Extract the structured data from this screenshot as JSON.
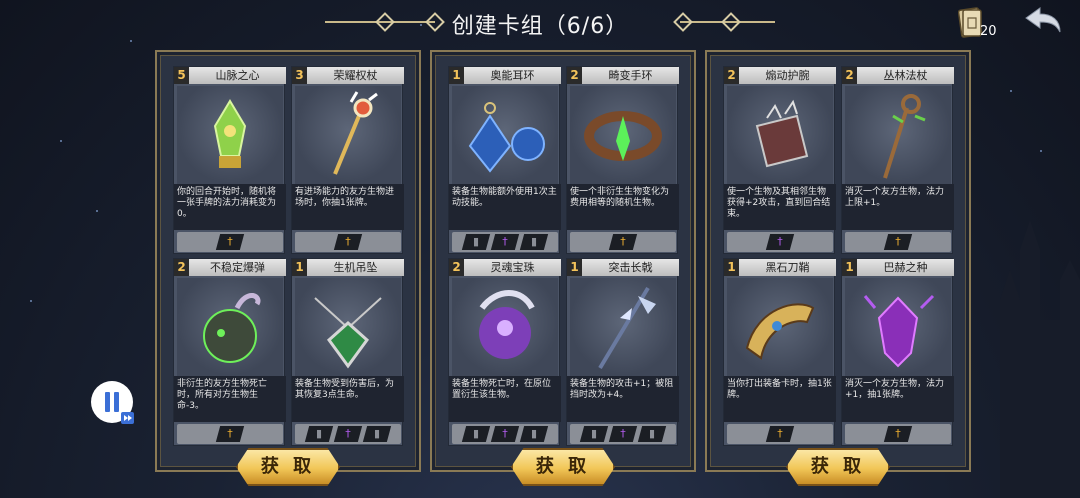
{
  "header": {
    "title": "创建卡组（6/6）",
    "deck_count": "20"
  },
  "panels": [
    {
      "cards": [
        {
          "cost": "5",
          "name": "山脉之心",
          "desc": "你的回合开始时，随机将一张手牌的法力消耗变为0。",
          "art": "green-crystal-icon",
          "slots": [
            "dagger"
          ]
        },
        {
          "cost": "3",
          "name": "荣耀权杖",
          "desc": "有进场能力的友方生物进场时，你抽1张牌。",
          "art": "scepter-icon",
          "slots": [
            "dagger"
          ]
        },
        {
          "cost": "2",
          "name": "不稳定爆弹",
          "desc": "非衍生的友方生物死亡时，所有对方生物生命-3。",
          "art": "bomb-icon",
          "slots": [
            "dagger"
          ]
        },
        {
          "cost": "1",
          "name": "生机吊坠",
          "desc": "装备生物受到伤害后，为其恢复3点生命。",
          "art": "pendant-icon",
          "slots": [
            "helmet",
            "dagger-purple",
            "helmet"
          ]
        }
      ],
      "button": "获 取"
    },
    {
      "cards": [
        {
          "cost": "1",
          "name": "奥能耳环",
          "desc": "装备生物能额外使用1次主动技能。",
          "art": "earring-icon",
          "slots": [
            "helmet",
            "dagger-purple",
            "helmet"
          ]
        },
        {
          "cost": "2",
          "name": "畸变手环",
          "desc": "使一个非衍生生物变化为费用相等的随机生物。",
          "art": "bracelet-icon",
          "slots": [
            "dagger"
          ]
        },
        {
          "cost": "2",
          "name": "灵魂宝珠",
          "desc": "装备生物死亡时，在原位置衍生该生物。",
          "art": "soul-orb-icon",
          "slots": [
            "helmet",
            "dagger-purple",
            "helmet"
          ]
        },
        {
          "cost": "1",
          "name": "突击长戟",
          "desc": "装备生物的攻击+1；被阻挡时改为+4。",
          "art": "halberd-icon",
          "slots": [
            "helmet",
            "dagger-purple",
            "helmet"
          ]
        }
      ],
      "button": "获 取"
    },
    {
      "cards": [
        {
          "cost": "2",
          "name": "煽动护腕",
          "desc": "使一个生物及其相邻生物获得+2攻击，直到回合结束。",
          "art": "bracer-icon",
          "slots": [
            "dagger-purple"
          ]
        },
        {
          "cost": "2",
          "name": "丛林法杖",
          "desc": "消灭一个友方生物，法力上限+1。",
          "art": "staff-icon",
          "slots": [
            "dagger"
          ]
        },
        {
          "cost": "1",
          "name": "黑石刀鞘",
          "desc": "当你打出装备卡时，抽1张牌。",
          "art": "horn-icon",
          "slots": [
            "dagger"
          ]
        },
        {
          "cost": "1",
          "name": "巴赫之种",
          "desc": "消灭一个友方生物，法力+1，抽1张牌。",
          "art": "seed-icon",
          "slots": [
            "dagger"
          ]
        }
      ],
      "button": "获 取"
    }
  ],
  "colors": {
    "gold": "#f1c657",
    "frame": "#8a7a55",
    "dagger": "#f0b030",
    "dagger_purple": "#b45cf0"
  }
}
